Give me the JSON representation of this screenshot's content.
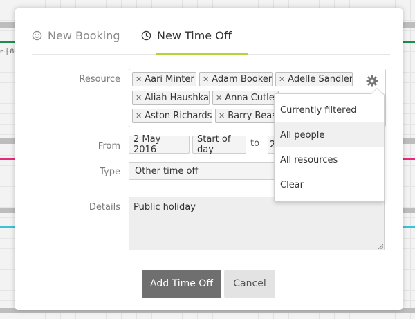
{
  "background": {
    "truncated_label": "n | 8h",
    "colors": {
      "green_line": "#1a8f4a",
      "pink_line": "#e8287a",
      "cyan_line": "#39c3d6"
    }
  },
  "modal": {
    "tabs": [
      {
        "label": "New Booking",
        "icon": "smiley-icon",
        "active": false
      },
      {
        "label": "New Time Off",
        "icon": "clock-icon",
        "active": true
      }
    ],
    "accent_color": "#b4d335",
    "resource": {
      "label": "Resource",
      "chips": [
        "Aari Minter",
        "Adam Booker",
        "Adelle Sandler",
        "Aliah Haushka",
        "Anna Cutler",
        "Aston Richards",
        "Barry Beasl"
      ]
    },
    "from": {
      "label": "From",
      "date": "2 May 2016",
      "period": "Start of day",
      "to_label": "to",
      "to_date_partial": "2"
    },
    "type": {
      "label": "Type",
      "value": "Other time off"
    },
    "details": {
      "label": "Details",
      "value": "Public holiday"
    },
    "buttons": {
      "primary": "Add Time Off",
      "cancel": "Cancel"
    },
    "resource_menu": {
      "items": [
        "Currently filtered",
        "All people",
        "All resources",
        "Clear"
      ],
      "highlighted": "All people"
    }
  }
}
